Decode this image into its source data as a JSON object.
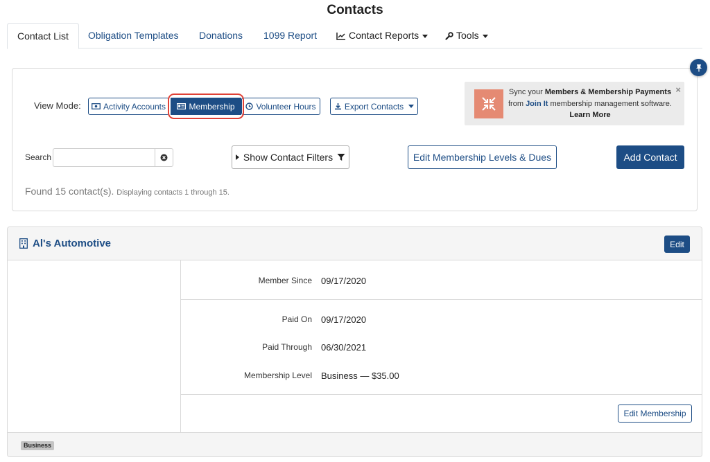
{
  "page": {
    "title": "Contacts"
  },
  "tabs": [
    {
      "label": "Contact List",
      "active": true
    },
    {
      "label": "Obligation Templates"
    },
    {
      "label": "Donations"
    },
    {
      "label": "1099 Report"
    },
    {
      "label": "Contact Reports",
      "icon": "chart-line-icon",
      "dropdown": true
    },
    {
      "label": "Tools",
      "icon": "wrench-icon",
      "dropdown": true
    }
  ],
  "view_mode": {
    "label": "View Mode:",
    "options": [
      {
        "label": "Activity Accounts",
        "icon": "money-icon"
      },
      {
        "label": "Membership",
        "icon": "id-card-icon",
        "selected": true
      },
      {
        "label": "Volunteer Hours",
        "icon": "clock-icon"
      }
    ],
    "export_label": "Export Contacts"
  },
  "promo": {
    "text_before": "Sync your ",
    "text_bold": "Members & Membership Payments",
    "text_from": "from ",
    "link": "Join It",
    "text_after": " membership management software.",
    "learn_more": "Learn More",
    "close": "×"
  },
  "search": {
    "label": "Search",
    "value": "",
    "placeholder": ""
  },
  "buttons": {
    "filters": "Show Contact Filters",
    "levels": "Edit Membership Levels & Dues",
    "add": "Add Contact"
  },
  "results": {
    "found": "Found 15 contact(s).",
    "displaying": "Displaying contacts 1 through 15."
  },
  "contact": {
    "name": "Al's Automotive",
    "edit_label": "Edit",
    "member_since_label": "Member Since",
    "member_since": "09/17/2020",
    "paid_on_label": "Paid On",
    "paid_on": "09/17/2020",
    "paid_through_label": "Paid Through",
    "paid_through": "06/30/2021",
    "level_label": "Membership Level",
    "level": "Business — $35.00",
    "edit_membership_label": "Edit Membership",
    "badge": "Business"
  },
  "colors": {
    "primary": "#1d4d85",
    "highlight": "#e04136",
    "promo_icon_bg": "#e58a73"
  }
}
